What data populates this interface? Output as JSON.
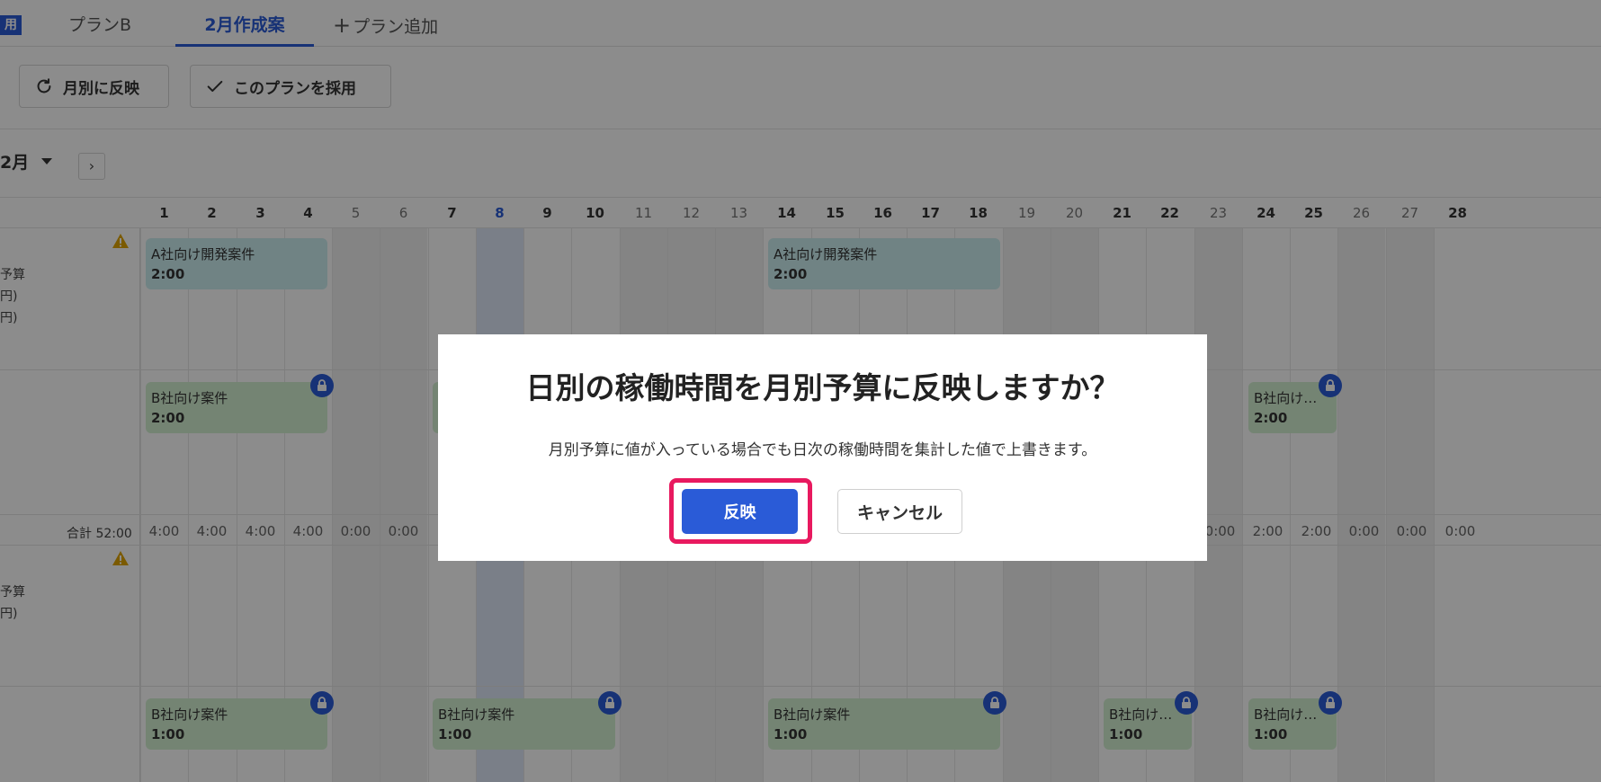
{
  "tabs": {
    "badge": "用",
    "plan_b": "プランB",
    "active": "2月作成案",
    "add": "プラン追加"
  },
  "toolbar": {
    "reflect_monthly": "月別に反映",
    "adopt_plan": "このプランを採用"
  },
  "month": {
    "label": "2月",
    "next": "›"
  },
  "days": [
    "1",
    "2",
    "3",
    "4",
    "5",
    "6",
    "7",
    "8",
    "9",
    "10",
    "11",
    "12",
    "13",
    "14",
    "15",
    "16",
    "17",
    "18",
    "19",
    "20",
    "21",
    "22",
    "23",
    "24",
    "25",
    "26",
    "27",
    "28"
  ],
  "section1": {
    "label_lines": [
      "予算",
      "円)",
      "円)"
    ],
    "tasks": [
      {
        "name": "A社向け開発案件",
        "time": "2:00"
      },
      {
        "name": "A社向け開発案件",
        "time": "2:00"
      },
      {
        "name": "B社向け案件",
        "time": "2:00"
      },
      {
        "name": "B社向け…",
        "time": "2:00"
      }
    ],
    "total_label": "合計 52:00",
    "totals_left": [
      "4:00",
      "4:00",
      "4:00",
      "4:00",
      "0:00",
      "0:00"
    ],
    "totals_right": [
      "0:00",
      "2:00",
      "2:00",
      "0:00",
      "0:00",
      "0:00"
    ]
  },
  "section2": {
    "label_lines": [
      "予算",
      "円)"
    ],
    "tasks": [
      {
        "name": "B社向け案件",
        "time": "1:00"
      },
      {
        "name": "B社向け案件",
        "time": "1:00"
      },
      {
        "name": "B社向け案件",
        "time": "1:00"
      },
      {
        "name": "B社向け…",
        "time": "1:00"
      },
      {
        "name": "B社向け…",
        "time": "1:00"
      }
    ]
  },
  "dialog": {
    "title": "日別の稼働時間を月別予算に反映しますか？",
    "message": "月別予算に値が入っている場合でも日次の稼働時間を集計した値で上書きます。",
    "confirm": "反映",
    "cancel": "キャンセル"
  },
  "colors": {
    "primary": "#2a5bd7",
    "highlight": "#e8195f",
    "teal_task": "#cdeef1",
    "green_task": "#d4f0d2"
  }
}
